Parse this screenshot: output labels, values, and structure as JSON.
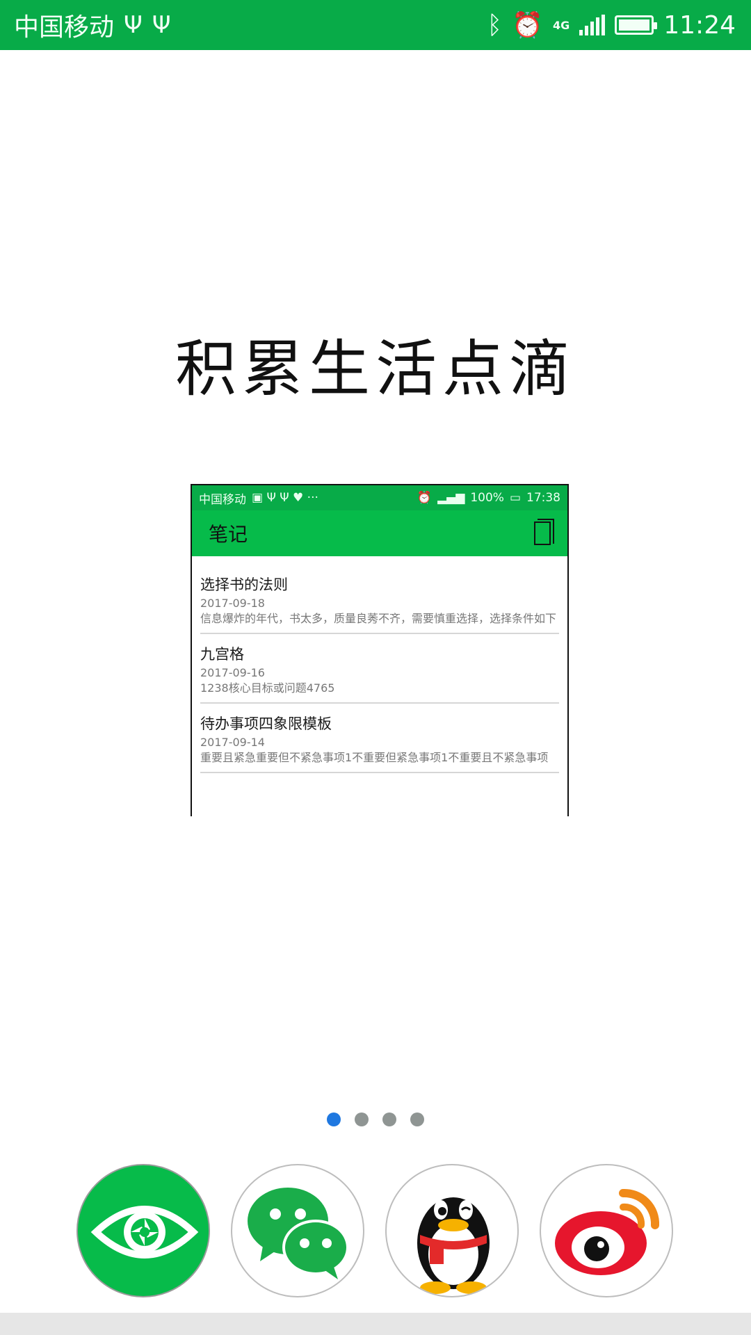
{
  "status_bar": {
    "carrier": "中国移动",
    "network": "4G",
    "time": "11:24"
  },
  "headline": "积累生活点滴",
  "preview": {
    "status_bar": {
      "carrier": "中国移动",
      "battery_percent": "100%",
      "time": "17:38"
    },
    "toolbar_title": "笔记",
    "notes": [
      {
        "title": "选择书的法则",
        "date": "2017-09-18",
        "body": "信息爆炸的年代，书太多，质量良莠不齐，需要慎重选择，选择条件如下"
      },
      {
        "title": "九宫格",
        "date": "2017-09-16",
        "body": "1238核心目标或问题4765"
      },
      {
        "title": "待办事项四象限模板",
        "date": "2017-09-14",
        "body": "重要且紧急重要但不紧急事项1不重要但紧急事项1不重要且不紧急事项"
      }
    ]
  },
  "pager": {
    "count": 4,
    "active_index": 0
  },
  "login_buttons": [
    {
      "icon": "eye-icon",
      "color": "#07bb4a"
    },
    {
      "icon": "wechat-icon",
      "color": "#1aad4a"
    },
    {
      "icon": "qq-penguin-icon",
      "color": "#111111"
    },
    {
      "icon": "weibo-icon",
      "color": "#e6162d"
    }
  ],
  "colors": {
    "status_bar": "#08ab48",
    "accent_green": "#06bb4a",
    "dot_active": "#1f78e0",
    "dot_inactive": "#8f9593"
  }
}
